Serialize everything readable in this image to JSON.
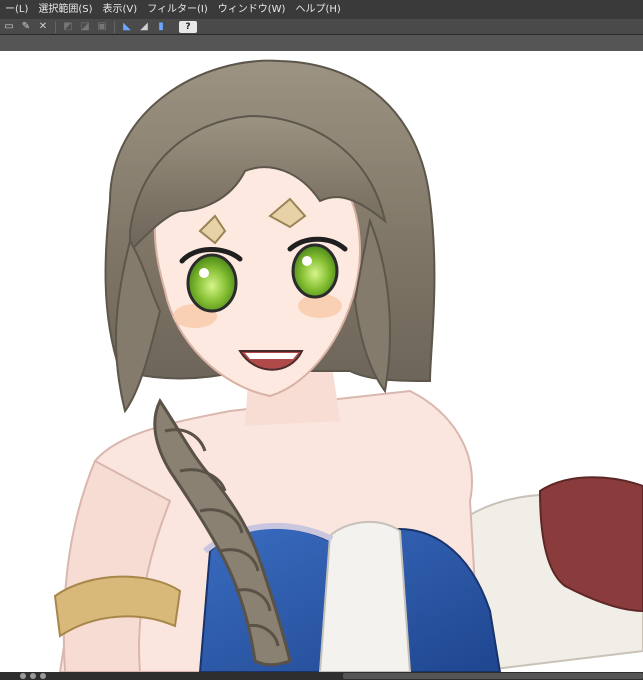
{
  "menu": {
    "items": [
      "ー(L)",
      "選択範囲(S)",
      "表示(V)",
      "フィルター(I)",
      "ウィンドウ(W)",
      "ヘルプ(H)"
    ]
  },
  "toolbar": {
    "help_label": "?"
  },
  "icons": {
    "toolbar": [
      "layer-icon",
      "transform-icon",
      "clear-icon",
      "fill-icon",
      "brush-icon",
      "eraser-icon",
      "ruler-icon",
      "snap-icon",
      "pen-pressure-icon"
    ]
  },
  "colors": {
    "menubar_bg": "#3a3a3a",
    "toolbar_bg": "#4a4a4a",
    "accent_blue": "#6aa7ff",
    "hair": "#8e8372",
    "eyes": "#86c034",
    "dress": "#2f5fb0",
    "glove": "#8a3b3b"
  }
}
